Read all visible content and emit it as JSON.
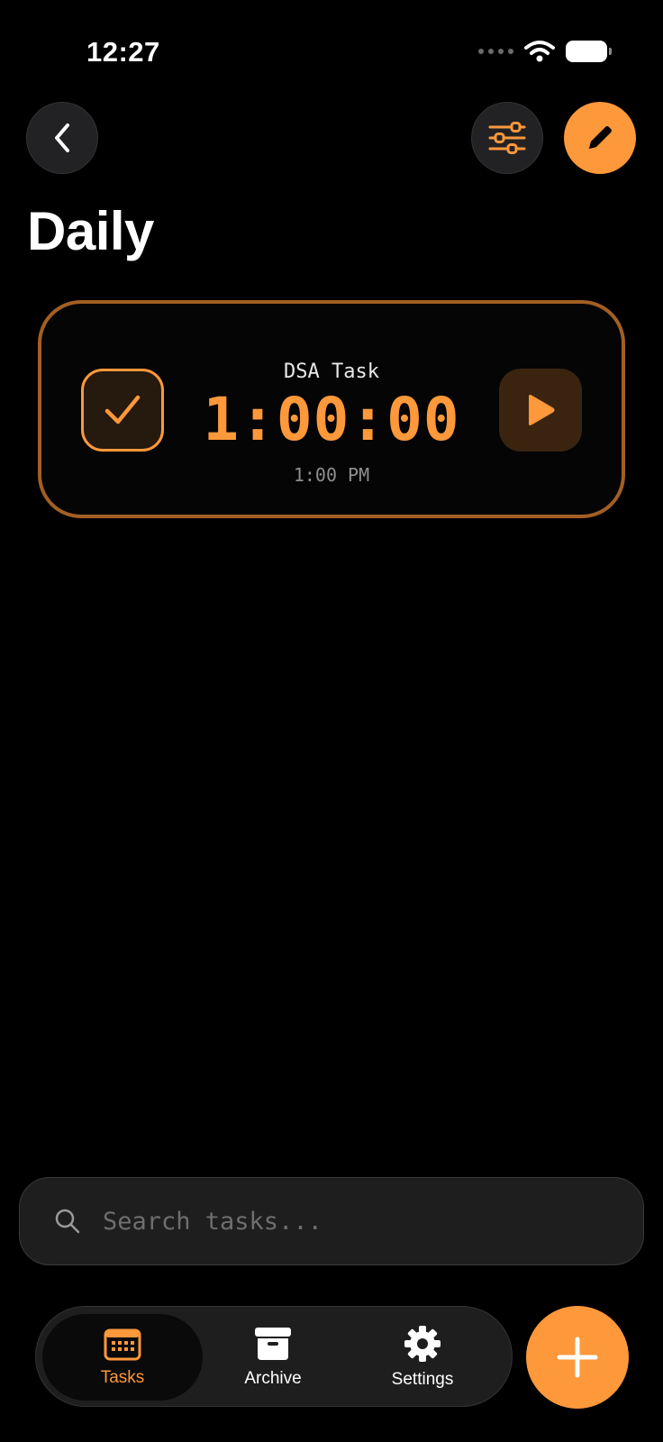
{
  "status_bar": {
    "time": "12:27"
  },
  "header": {
    "back_icon": "chevron-left-icon",
    "filter_icon": "sliders-icon",
    "edit_icon": "pencil-icon",
    "title": "Daily"
  },
  "task": {
    "name": "DSA Task",
    "timer": "1:00:00",
    "time": "1:00 PM",
    "completed": true
  },
  "search": {
    "placeholder": "Search tasks...",
    "value": ""
  },
  "tab_bar": {
    "items": [
      {
        "label": "Tasks",
        "icon": "calendar-icon",
        "active": true
      },
      {
        "label": "Archive",
        "icon": "archive-box-icon",
        "active": false
      },
      {
        "label": "Settings",
        "icon": "gear-icon",
        "active": false
      }
    ]
  },
  "colors": {
    "accent": "#fd983b",
    "card_border": "#a35f23",
    "background": "#000000"
  }
}
